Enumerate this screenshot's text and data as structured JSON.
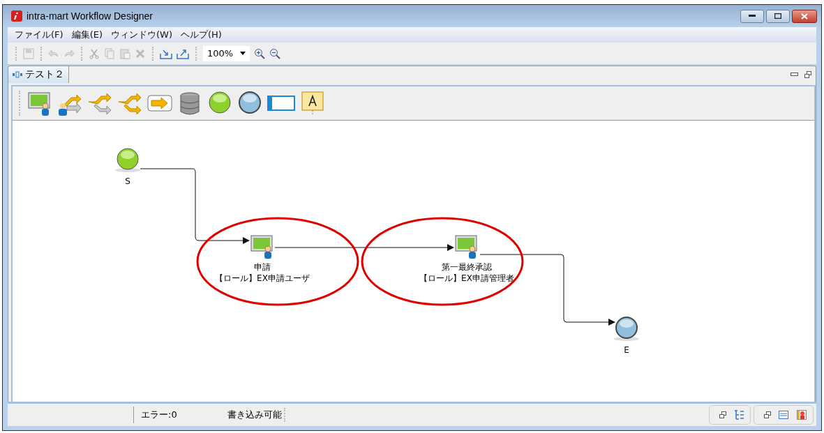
{
  "window": {
    "title": "intra-mart Workflow Designer"
  },
  "menu": [
    "ファイル(F)",
    "編集(E)",
    "ウィンドウ(W)",
    "ヘルプ(H)"
  ],
  "toolbar": {
    "zoom": "100%"
  },
  "tab": {
    "label": "テスト２"
  },
  "diagram": {
    "nodes": [
      {
        "kind": "start",
        "label": "S"
      },
      {
        "kind": "task",
        "label": "申請",
        "role": "【ロール】EX申請ユーザ",
        "circled": true
      },
      {
        "kind": "task",
        "label": "第一最終承認",
        "role": "【ロール】EX申請管理者",
        "circled": true
      },
      {
        "kind": "end",
        "label": "E"
      }
    ]
  },
  "status_bar": {
    "errors": "エラー:0",
    "mode": "書き込み可能"
  }
}
